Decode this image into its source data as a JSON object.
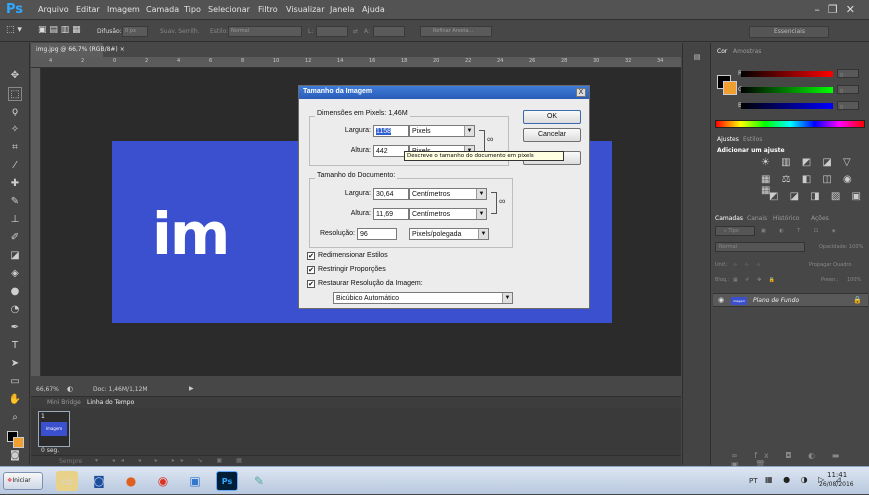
{
  "app": {
    "logo": "Ps"
  },
  "menu": [
    "Arquivo",
    "Editar",
    "Imagem",
    "Camada",
    "Tipo",
    "Selecionar",
    "Filtro",
    "Visualizar",
    "Janela",
    "Ajuda"
  ],
  "options_bar": {
    "difusao_label": "Difusão:",
    "difusao_value": "0 px",
    "suav_label": "Suav. Serrilh.",
    "estilo_label": "Estilo:",
    "estilo_value": "Normal",
    "l_label": "L:",
    "a_label": "A:",
    "refinar_label": "Refinar Aresta...",
    "workspace": "Essenciais"
  },
  "document": {
    "tab_title": "img.jpg @ 66,7% (RGB/8#)",
    "ruler_ticks": [
      "4",
      "2",
      "0",
      "2",
      "4",
      "6",
      "8",
      "10",
      "12",
      "14",
      "16",
      "18",
      "20",
      "22",
      "24",
      "26",
      "28",
      "30",
      "32",
      "34"
    ],
    "canvas_text": "im",
    "canvas_color": "#3a50cf",
    "zoom": "66,67%",
    "doc_info": "Doc: 1,46M/1,12M"
  },
  "timeline": {
    "tabs": [
      "Mini Bridge",
      "Linha do Tempo"
    ],
    "frame_number": "1",
    "frame_label": "Imagem",
    "frame_delay": "0 seg.",
    "loop": "Sempre"
  },
  "panels": {
    "color_tabs": [
      "Cor",
      "Amostras"
    ],
    "r_label": "R",
    "g_label": "G",
    "b_label": "B",
    "r_value": "0",
    "g_value": "0",
    "b_value": "0",
    "adjust_tabs": [
      "Ajustes",
      "Estilos"
    ],
    "adjust_title": "Adicionar um ajuste",
    "layer_tabs": [
      "Camadas",
      "Canais",
      "Histórico",
      "Ações"
    ],
    "layer_kind": "Tipo",
    "blend_mode": "Normal",
    "opacity_label": "Opacidade:",
    "opacity_value": "100%",
    "unif_label": "Unif.:",
    "propagate_label": "Propagar Quadro",
    "lock_label": "Bloq.:",
    "fill_label": "Preen.:",
    "fill_value": "100%",
    "layer_name": "Plano de Fundo",
    "layer_thumb": "imagem"
  },
  "dialog": {
    "title": "Tamanho da Imagem",
    "close": "X",
    "pixel_dims_label": "Dimensões em Pixels:",
    "pixel_dims_size": "1,46M",
    "width_label": "Largura:",
    "width_value": "1158",
    "width_unit": "Pixels",
    "height_label": "Altura:",
    "height_value": "442",
    "height_unit": "Pixels",
    "doc_size_label": "Tamanho do Documento:",
    "doc_width_label": "Largura:",
    "doc_width_value": "30,64",
    "doc_width_unit": "Centímetros",
    "doc_height_label": "Altura:",
    "doc_height_value": "11,69",
    "doc_height_unit": "Centímetros",
    "resolution_label": "Resolução:",
    "resolution_value": "96",
    "resolution_unit": "Pixels/polegada",
    "ok": "OK",
    "cancel": "Cancelar",
    "auto": "...",
    "scale_styles": "Redimensionar Estilos",
    "constrain": "Restringir Proporções",
    "resample": "Restaurar Resolução da Imagem:",
    "resample_method": "Bicúbico Automático",
    "tooltip": "Descreve o tamanho do documento em pixels"
  },
  "taskbar": {
    "start": "Iniciar",
    "lang": "PT",
    "time": "11:41",
    "date": "26/08/2016"
  }
}
